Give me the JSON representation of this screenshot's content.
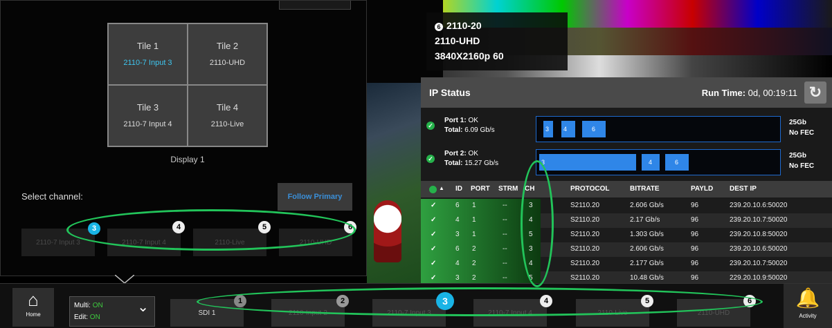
{
  "info": {
    "badge": "6",
    "line1": "2110-20",
    "line2": "2110-UHD",
    "line3": "3840X2160p 60"
  },
  "ip_status": {
    "title": "IP Status",
    "run_time_label": "Run Time:",
    "run_time_value": "0d, 00:19:11",
    "ports": [
      {
        "label": "Port 1:",
        "status": "OK",
        "total_label": "Total:",
        "total": "6.09 Gb/s",
        "segments": [
          "3",
          "4",
          "6"
        ],
        "speed": "25Gb",
        "fec": "No FEC"
      },
      {
        "label": "Port 2:",
        "status": "OK",
        "total_label": "Total:",
        "total": "15.27 Gb/s",
        "segments": [
          "3",
          "4",
          "6"
        ],
        "speed": "25Gb",
        "fec": "No FEC"
      }
    ],
    "columns": [
      "ID",
      "PORT",
      "STRM",
      "CH",
      "PROTOCOL",
      "BITRATE",
      "PAYLD",
      "DEST IP"
    ],
    "rows": [
      {
        "id": "6",
        "port": "1",
        "strm": "--",
        "ch": "3",
        "protocol": "S2110.20",
        "bitrate": "2.606 Gb/s",
        "payld": "96",
        "dest": "239.20.10.6:50020"
      },
      {
        "id": "4",
        "port": "1",
        "strm": "--",
        "ch": "4",
        "protocol": "S2110.20",
        "bitrate": "2.17 Gb/s",
        "payld": "96",
        "dest": "239.20.10.7:50020"
      },
      {
        "id": "3",
        "port": "1",
        "strm": "--",
        "ch": "5",
        "protocol": "S2110.20",
        "bitrate": "1.303 Gb/s",
        "payld": "96",
        "dest": "239.20.10.8:50020"
      },
      {
        "id": "6",
        "port": "2",
        "strm": "--",
        "ch": "3",
        "protocol": "S2110.20",
        "bitrate": "2.606 Gb/s",
        "payld": "96",
        "dest": "239.20.10.6:50020"
      },
      {
        "id": "4",
        "port": "2",
        "strm": "--",
        "ch": "4",
        "protocol": "S2110.20",
        "bitrate": "2.177 Gb/s",
        "payld": "96",
        "dest": "239.20.10.7:50020"
      },
      {
        "id": "3",
        "port": "2",
        "strm": "--",
        "ch": "5",
        "protocol": "S2110.20",
        "bitrate": "10.48 Gb/s",
        "payld": "96",
        "dest": "229.20.10.9:50020"
      }
    ]
  },
  "tiles": [
    {
      "title": "Tile 1",
      "source": "2110-7 Input 3",
      "active": true
    },
    {
      "title": "Tile 2",
      "source": "2110-UHD",
      "active": false
    },
    {
      "title": "Tile 3",
      "source": "2110-7 Input 4",
      "active": false
    },
    {
      "title": "Tile 4",
      "source": "2110-Live",
      "active": false
    }
  ],
  "display_label": "Display 1",
  "select_channel_label": "Select channel:",
  "follow_primary_label": "Follow Primary",
  "channels": [
    {
      "num": "3",
      "label": "2110-7 Input 3",
      "selected": true
    },
    {
      "num": "4",
      "label": "2110-7 Input 4",
      "selected": false
    },
    {
      "num": "5",
      "label": "2110-Live",
      "selected": false
    },
    {
      "num": "6",
      "label": "2110-UHD",
      "selected": false
    }
  ],
  "bottom": {
    "home_label": "Home",
    "multi_label": "Multi:",
    "multi_value": "ON",
    "edit_label": "Edit:",
    "edit_value": "ON",
    "buttons": [
      {
        "num": "1",
        "label": "SDI 1"
      },
      {
        "num": "2",
        "label": "2110-Input-2"
      },
      {
        "num": "3",
        "label": "2110-7 Input 3",
        "selected": true
      },
      {
        "num": "4",
        "label": "2110-7 Input 4"
      },
      {
        "num": "5",
        "label": "2110-Live"
      },
      {
        "num": "6",
        "label": "2110-UHD"
      }
    ],
    "activity_label": "Activity"
  },
  "colors": {
    "accent": "#19b4e6",
    "ok_green": "#26b24b",
    "highlight_oval": "#22c45a",
    "bar_blue": "#2f86e8"
  }
}
